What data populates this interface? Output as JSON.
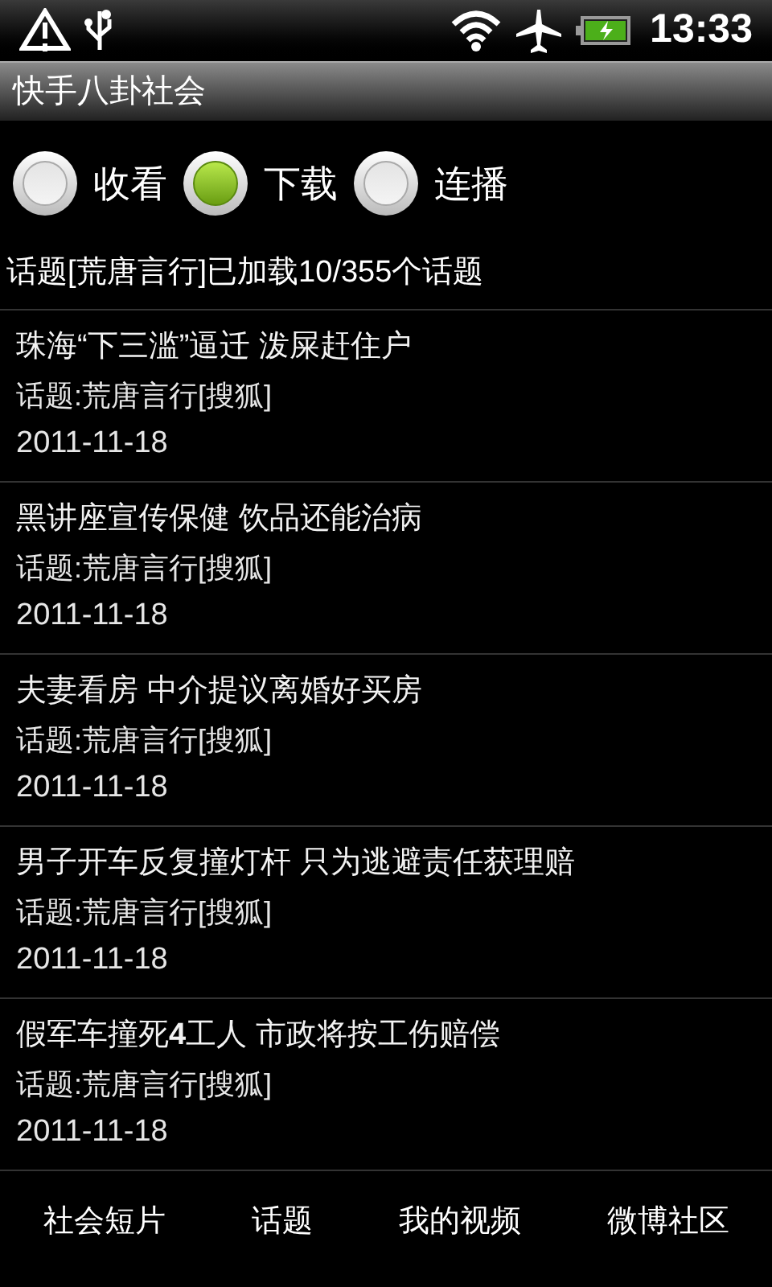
{
  "status_bar": {
    "time": "13:33"
  },
  "window": {
    "title": "快手八卦社会"
  },
  "modes": [
    {
      "label": "收看",
      "selected": false
    },
    {
      "label": "下载",
      "selected": true
    },
    {
      "label": "连播",
      "selected": false
    }
  ],
  "info": "话题[荒唐言行]已加载10/355个话题",
  "items": [
    {
      "title": "珠海“下三滥”逼迁 泼屎赶住户",
      "topic": "话题:荒唐言行[搜狐]",
      "date": "2011-11-18"
    },
    {
      "title": "黑讲座宣传保健 饮品还能治病",
      "topic": "话题:荒唐言行[搜狐]",
      "date": "2011-11-18"
    },
    {
      "title": "夫妻看房 中介提议离婚好买房",
      "topic": "话题:荒唐言行[搜狐]",
      "date": "2011-11-18"
    },
    {
      "title": "男子开车反复撞灯杆 只为逃避责任获理赔",
      "topic": "话题:荒唐言行[搜狐]",
      "date": "2011-11-18"
    },
    {
      "title": "假军车撞死**4**工人 市政将按工伤赔偿",
      "topic": "话题:荒唐言行[搜狐]",
      "date": "2011-11-18"
    }
  ],
  "tabs": [
    {
      "label": "社会短片"
    },
    {
      "label": "话题"
    },
    {
      "label": "我的视频"
    },
    {
      "label": "微博社区"
    }
  ]
}
